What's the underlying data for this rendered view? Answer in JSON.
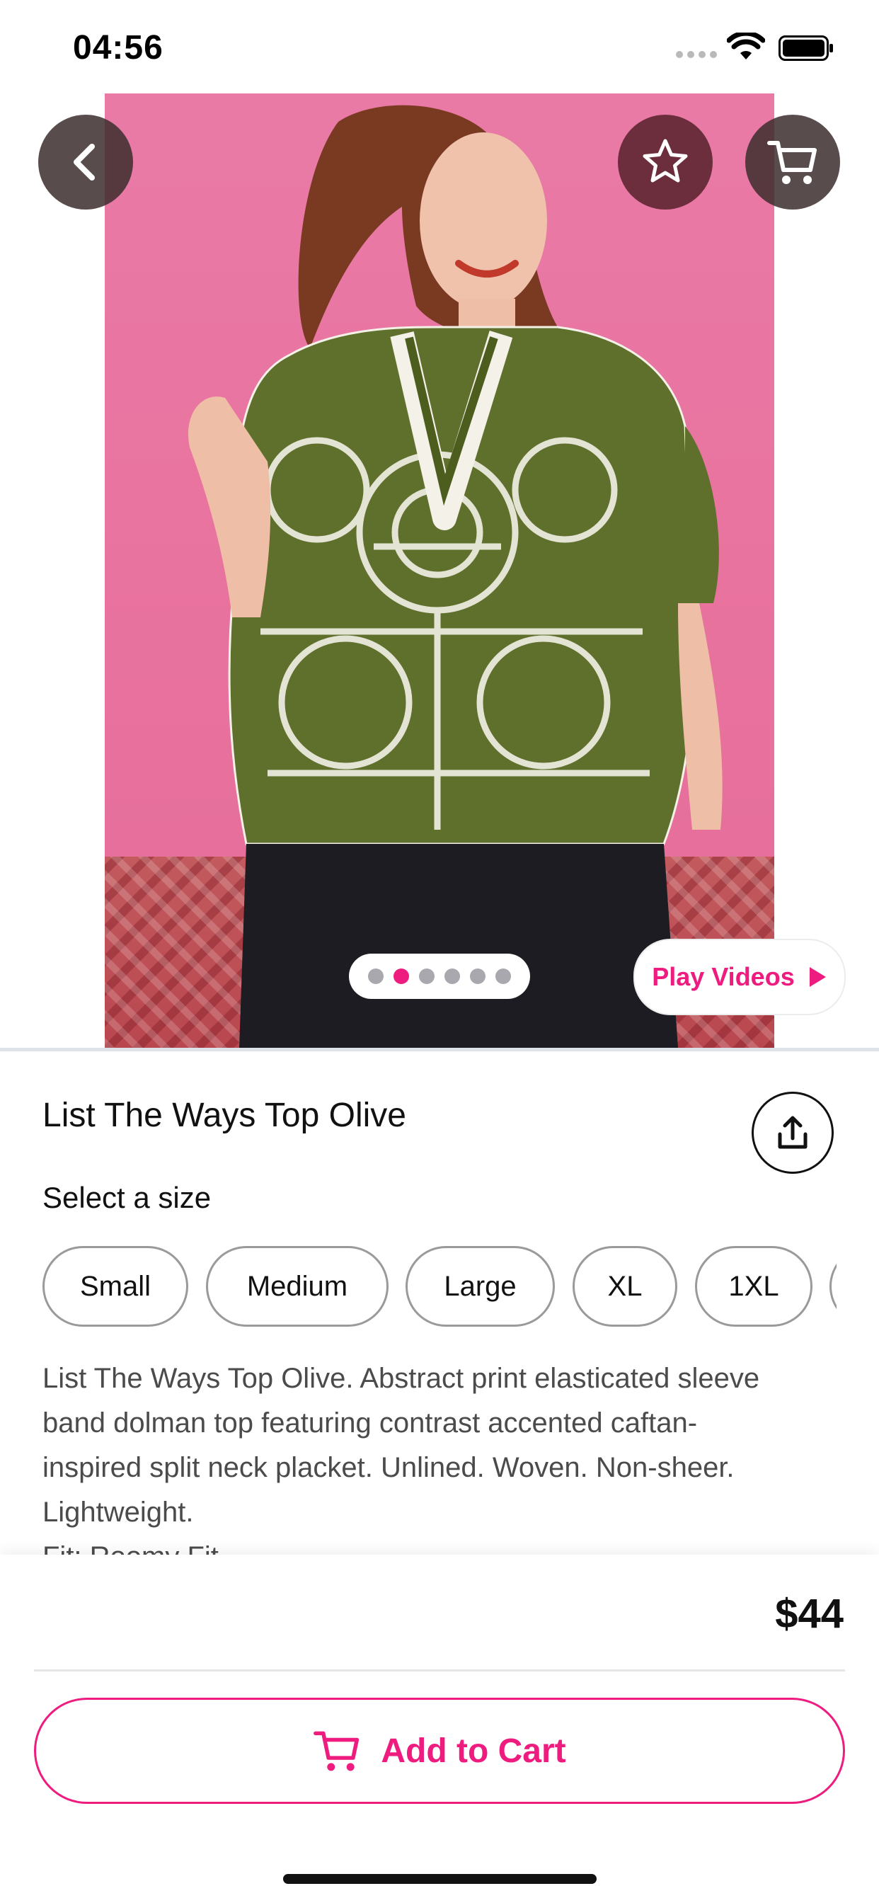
{
  "status_bar": {
    "time": "04:56"
  },
  "icons": {
    "back": "chevron-left-icon",
    "favorite": "star-icon",
    "cart": "cart-icon",
    "share": "share-icon",
    "play": "play-icon"
  },
  "gallery": {
    "image_count": 6,
    "active_index": 1,
    "play_videos_label": "Play Videos"
  },
  "product": {
    "title": "List The Ways Top Olive",
    "size_prompt": "Select a size",
    "sizes": [
      "Small",
      "Medium",
      "Large",
      "XL",
      "1XL"
    ],
    "description_lines": [
      "List The Ways Top Olive. Abstract  print elasticated sleeve",
      "band dolman top featuring contrast accented caftan-",
      "inspired split neck placket. Unlined. Woven. Non-sheer.",
      "Lightweight.",
      "Fit: Roomy Fit"
    ],
    "price": "$44"
  },
  "cta": {
    "add_to_cart_label": "Add to Cart"
  },
  "colors": {
    "accent": "#ee1c7f",
    "text": "#111111",
    "muted_text": "#4b4b4b"
  }
}
